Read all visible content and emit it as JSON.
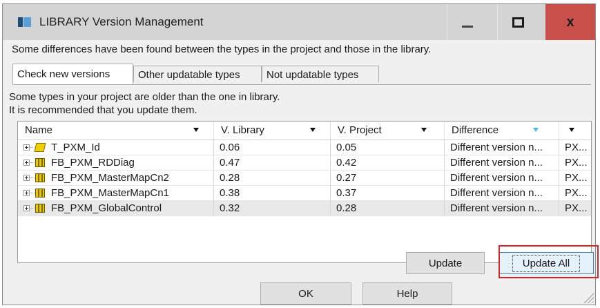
{
  "window": {
    "title": "LIBRARY Version Management",
    "minimize_glyph": "—",
    "close_glyph": "x",
    "message": "Some differences have been found between the types in the project and those in the library."
  },
  "tabs": [
    {
      "label": "Check new versions",
      "active": true
    },
    {
      "label": "Other updatable types",
      "active": false
    },
    {
      "label": "Not updatable types",
      "active": false
    }
  ],
  "panel": {
    "line1": "Some types in your project are older than the one in library.",
    "line2": "It is recommended that you update them."
  },
  "grid": {
    "columns": [
      {
        "label": "Name"
      },
      {
        "label": "V. Library"
      },
      {
        "label": "V. Project"
      },
      {
        "label": "Difference"
      },
      {
        "label": ""
      }
    ],
    "rows": [
      {
        "icon": "udt-type-icon",
        "name": "T_PXM_Id",
        "v_library": "0.06",
        "v_project": "0.05",
        "difference": "Different version n...",
        "extra": "PX..."
      },
      {
        "icon": "function-block-icon",
        "name": "FB_PXM_RDDiag",
        "v_library": "0.47",
        "v_project": "0.42",
        "difference": "Different version n...",
        "extra": "PX..."
      },
      {
        "icon": "function-block-icon",
        "name": "FB_PXM_MasterMapCn2",
        "v_library": "0.28",
        "v_project": "0.27",
        "difference": "Different version n...",
        "extra": "PX..."
      },
      {
        "icon": "function-block-icon",
        "name": "FB_PXM_MasterMapCn1",
        "v_library": "0.38",
        "v_project": "0.37",
        "difference": "Different version n...",
        "extra": "PX..."
      },
      {
        "icon": "function-block-icon",
        "name": "FB_PXM_GlobalControl",
        "v_library": "0.32",
        "v_project": "0.28",
        "difference": "Different version n...",
        "extra": "PX...",
        "selected": true
      }
    ]
  },
  "buttons": {
    "update": "Update",
    "update_all": "Update All",
    "ok": "OK",
    "help": "Help"
  },
  "colors": {
    "title_bar": "#d4d4d4",
    "close_button": "#c7504b",
    "highlight_box": "#d9232d",
    "filter_arrow": "#4fb7e8"
  }
}
